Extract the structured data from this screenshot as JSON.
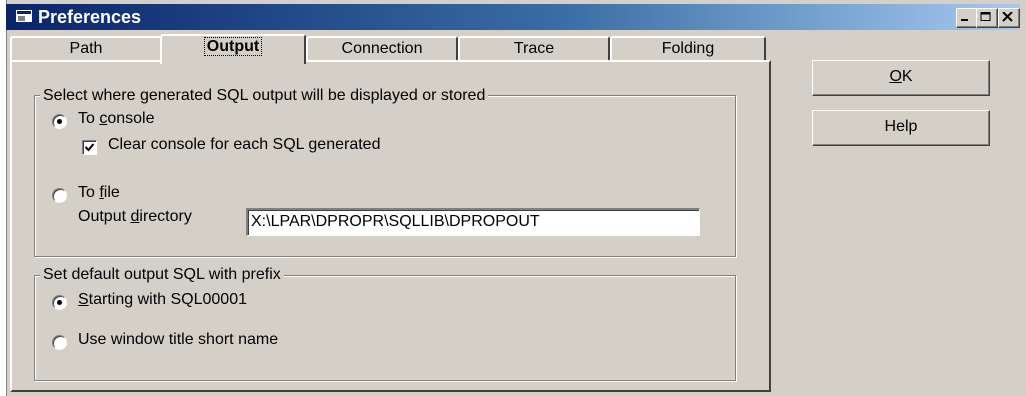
{
  "window": {
    "title": "Preferences"
  },
  "tabs": [
    {
      "label": "Path"
    },
    {
      "label": "Output"
    },
    {
      "label": "Connection"
    },
    {
      "label": "Trace"
    },
    {
      "label": "Folding"
    }
  ],
  "output_group": {
    "legend": "Select where generated SQL output will be displayed or stored",
    "to_console": {
      "pre": "To ",
      "accel": "c",
      "post": "onsole",
      "selected": true
    },
    "clear_console": {
      "label": "Clear console for each SQL generated",
      "checked": true
    },
    "to_file": {
      "pre": "To ",
      "accel": "f",
      "post": "ile",
      "selected": false
    },
    "output_directory": {
      "pre": "Output ",
      "accel": "d",
      "post": "irectory",
      "value": "X:\\LPAR\\DPROPR\\SQLLIB\\DPROPOUT"
    }
  },
  "prefix_group": {
    "legend": "Set default output SQL with prefix",
    "starting_with": {
      "accel": "S",
      "post": "tarting with SQL00001",
      "selected": true
    },
    "use_window_title": {
      "label": "Use window title short name",
      "selected": false
    }
  },
  "buttons": {
    "ok": {
      "accel": "O",
      "post": "K"
    },
    "help": {
      "label": "Help"
    }
  }
}
